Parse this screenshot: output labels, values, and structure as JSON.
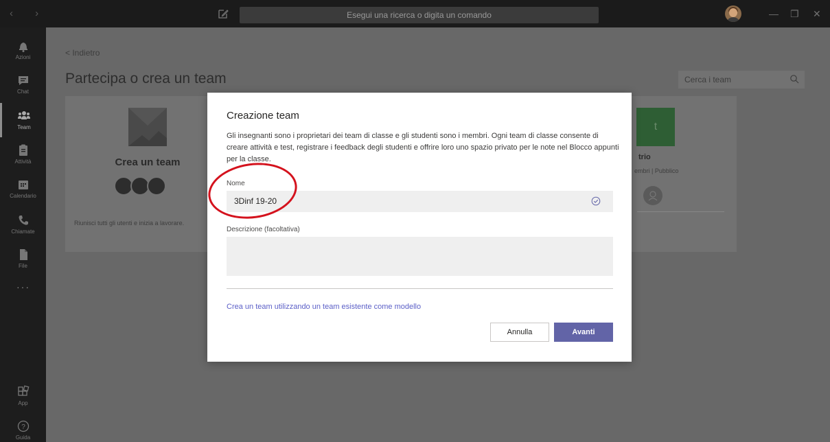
{
  "titlebar": {
    "nav_arrows": "‹ ›",
    "search_placeholder": "Esegui una ricerca o digita un comando",
    "window_buttons": {
      "minimize": "—",
      "restore": "❐",
      "close": "✕"
    }
  },
  "rail": {
    "items": [
      {
        "label": "Azioni",
        "icon": "bell-icon"
      },
      {
        "label": "Chat",
        "icon": "chat-icon"
      },
      {
        "label": "Team",
        "icon": "team-icon"
      },
      {
        "label": "Attività",
        "icon": "assignment-icon"
      },
      {
        "label": "Calendario",
        "icon": "calendar-icon"
      },
      {
        "label": "Chiamate",
        "icon": "phone-icon"
      },
      {
        "label": "File",
        "icon": "file-icon"
      }
    ],
    "more": "···",
    "apps_label": "App",
    "help_label": "Guida"
  },
  "page": {
    "back_label": "< Indietro",
    "title": "Partecipa o crea un team",
    "search_placeholder": "Cerca i team",
    "create_card": {
      "title": "Crea un team",
      "description": "Riunisci tutti gli utenti e inizia a lavorare."
    },
    "team_card": {
      "initial": "t",
      "name": "trio",
      "info": "embri | Pubblico"
    }
  },
  "modal": {
    "title": "Creazione team",
    "description": "Gli insegnanti sono i proprietari dei team di classe e gli studenti sono i membri. Ogni team di classe consente di creare attività e test, registrare i feedback degli studenti e offrire loro uno spazio privato per le note nel Blocco appunti per la classe.",
    "name_label": "Nome",
    "name_value": "3Dinf 19-20",
    "description_label": "Descrizione (facoltativa)",
    "description_value": "",
    "template_link": "Crea un team utilizzando un team esistente come modello",
    "cancel_label": "Annulla",
    "next_label": "Avanti"
  },
  "colors": {
    "accent": "#6264a7",
    "annotation": "#d4121d"
  }
}
